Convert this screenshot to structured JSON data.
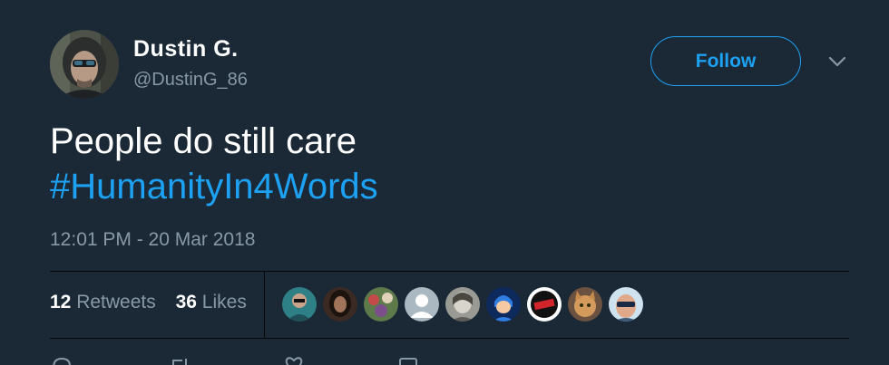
{
  "author": {
    "display_name": "Dustin G.",
    "handle": "@DustinG_86"
  },
  "follow_button": {
    "label": "Follow"
  },
  "tweet": {
    "text": "People do still care",
    "hashtag": "#HumanityIn4Words",
    "timestamp": "12:01 PM - 20 Mar 2018"
  },
  "stats": {
    "retweets_count": "12",
    "retweets_label": "Retweets",
    "likes_count": "36",
    "likes_label": "Likes"
  },
  "liker_avatars": [
    "avatar-1",
    "avatar-2",
    "avatar-3",
    "avatar-4",
    "avatar-5",
    "avatar-6",
    "avatar-7",
    "avatar-8",
    "avatar-9"
  ],
  "icons": {
    "more": "chevron-down-icon",
    "reply": "reply-icon",
    "retweet": "retweet-icon",
    "like": "heart-icon",
    "message": "message-icon"
  },
  "colors": {
    "background": "#1b2836",
    "accent": "#1da1f2",
    "secondary_text": "#8899a6",
    "primary_text": "#ffffff"
  }
}
